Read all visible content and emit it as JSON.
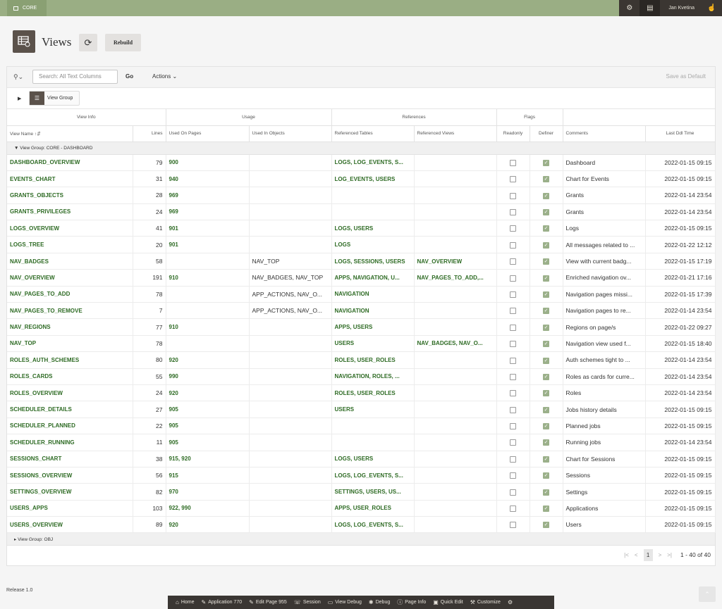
{
  "topbar": {
    "app_label": "CORE",
    "user_name": "Jan Kvetina"
  },
  "page": {
    "title": "Views",
    "rebuild_label": "Rebuild"
  },
  "toolbar": {
    "search_placeholder": "Search: All Text Columns",
    "go_label": "Go",
    "actions_label": "Actions",
    "save_default_label": "Save as Default"
  },
  "view_group_button": "View Group",
  "column_groups": {
    "view_info": "View Info",
    "usage": "Usage",
    "references": "References",
    "flags": "Flags"
  },
  "columns": {
    "view_name": "View Name",
    "lines": "Lines",
    "used_on_pages": "Used On Pages",
    "used_in_objects": "Used In Objects",
    "referenced_tables": "Referenced Tables",
    "referenced_views": "Referenced Views",
    "readonly": "Readonly",
    "definer": "Definer",
    "comments": "Comments",
    "last_ddl_time": "Last Ddl Time"
  },
  "break_groups": [
    "View Group: CORE - DASHBOARD",
    "View Group: OBJ"
  ],
  "rows": [
    {
      "name": "DASHBOARD_OVERVIEW",
      "lines": "79",
      "pages": "900",
      "objects": "",
      "tables": "LOGS, LOG_EVENTS, S...",
      "views": "",
      "readonly": false,
      "definer": true,
      "comment": "Dashboard",
      "ddl": "2022-01-15 09:15"
    },
    {
      "name": "EVENTS_CHART",
      "lines": "31",
      "pages": "940",
      "objects": "",
      "tables": "LOG_EVENTS, USERS",
      "views": "",
      "readonly": false,
      "definer": true,
      "comment": "Chart for Events",
      "ddl": "2022-01-15 09:15"
    },
    {
      "name": "GRANTS_OBJECTS",
      "lines": "28",
      "pages": "969",
      "objects": "",
      "tables": "",
      "views": "",
      "readonly": false,
      "definer": true,
      "comment": "Grants",
      "ddl": "2022-01-14 23:54"
    },
    {
      "name": "GRANTS_PRIVILEGES",
      "lines": "24",
      "pages": "969",
      "objects": "",
      "tables": "",
      "views": "",
      "readonly": false,
      "definer": true,
      "comment": "Grants",
      "ddl": "2022-01-14 23:54"
    },
    {
      "name": "LOGS_OVERVIEW",
      "lines": "41",
      "pages": "901",
      "objects": "",
      "tables": "LOGS, USERS",
      "views": "",
      "readonly": false,
      "definer": true,
      "comment": "Logs",
      "ddl": "2022-01-15 09:15"
    },
    {
      "name": "LOGS_TREE",
      "lines": "20",
      "pages": "901",
      "objects": "",
      "tables": "LOGS",
      "views": "",
      "readonly": false,
      "definer": true,
      "comment": "All messages related to ...",
      "ddl": "2022-01-22 12:12"
    },
    {
      "name": "NAV_BADGES",
      "lines": "58",
      "pages": "",
      "objects": "NAV_TOP",
      "tables": "LOGS, SESSIONS, USERS",
      "views": "NAV_OVERVIEW",
      "readonly": false,
      "definer": true,
      "comment": "View with current badg...",
      "ddl": "2022-01-15 17:19"
    },
    {
      "name": "NAV_OVERVIEW",
      "lines": "191",
      "pages": "910",
      "objects": "NAV_BADGES, NAV_TOP",
      "tables": "APPS, NAVIGATION, U...",
      "views": "NAV_PAGES_TO_ADD,...",
      "readonly": false,
      "definer": true,
      "comment": "Enriched navigation ov...",
      "ddl": "2022-01-21 17:16"
    },
    {
      "name": "NAV_PAGES_TO_ADD",
      "lines": "78",
      "pages": "",
      "objects": "APP_ACTIONS, NAV_O...",
      "tables": "NAVIGATION",
      "views": "",
      "readonly": false,
      "definer": true,
      "comment": "Navigation pages missi...",
      "ddl": "2022-01-15 17:39"
    },
    {
      "name": "NAV_PAGES_TO_REMOVE",
      "lines": "7",
      "pages": "",
      "objects": "APP_ACTIONS, NAV_O...",
      "tables": "NAVIGATION",
      "views": "",
      "readonly": false,
      "definer": true,
      "comment": "Navigation pages to re...",
      "ddl": "2022-01-14 23:54"
    },
    {
      "name": "NAV_REGIONS",
      "lines": "77",
      "pages": "910",
      "objects": "",
      "tables": "APPS, USERS",
      "views": "",
      "readonly": false,
      "definer": true,
      "comment": "Regions on page/s",
      "ddl": "2022-01-22 09:27"
    },
    {
      "name": "NAV_TOP",
      "lines": "78",
      "pages": "",
      "objects": "",
      "tables": "USERS",
      "views": "NAV_BADGES, NAV_O...",
      "readonly": false,
      "definer": true,
      "comment": "Navigation view used f...",
      "ddl": "2022-01-15 18:40"
    },
    {
      "name": "ROLES_AUTH_SCHEMES",
      "lines": "80",
      "pages": "920",
      "objects": "",
      "tables": "ROLES, USER_ROLES",
      "views": "",
      "readonly": false,
      "definer": true,
      "comment": "Auth schemes tight to ...",
      "ddl": "2022-01-14 23:54"
    },
    {
      "name": "ROLES_CARDS",
      "lines": "55",
      "pages": "990",
      "objects": "",
      "tables": "NAVIGATION, ROLES, ...",
      "views": "",
      "readonly": false,
      "definer": true,
      "comment": "Roles as cards for curre...",
      "ddl": "2022-01-14 23:54"
    },
    {
      "name": "ROLES_OVERVIEW",
      "lines": "24",
      "pages": "920",
      "objects": "",
      "tables": "ROLES, USER_ROLES",
      "views": "",
      "readonly": false,
      "definer": true,
      "comment": "Roles",
      "ddl": "2022-01-14 23:54"
    },
    {
      "name": "SCHEDULER_DETAILS",
      "lines": "27",
      "pages": "905",
      "objects": "",
      "tables": "USERS",
      "views": "",
      "readonly": false,
      "definer": true,
      "comment": "Jobs history details",
      "ddl": "2022-01-15 09:15"
    },
    {
      "name": "SCHEDULER_PLANNED",
      "lines": "22",
      "pages": "905",
      "objects": "",
      "tables": "",
      "views": "",
      "readonly": false,
      "definer": true,
      "comment": "Planned jobs",
      "ddl": "2022-01-15 09:15"
    },
    {
      "name": "SCHEDULER_RUNNING",
      "lines": "11",
      "pages": "905",
      "objects": "",
      "tables": "",
      "views": "",
      "readonly": false,
      "definer": true,
      "comment": "Running jobs",
      "ddl": "2022-01-14 23:54"
    },
    {
      "name": "SESSIONS_CHART",
      "lines": "38",
      "pages": "915, 920",
      "objects": "",
      "tables": "LOGS, USERS",
      "views": "",
      "readonly": false,
      "definer": true,
      "comment": "Chart for Sessions",
      "ddl": "2022-01-15 09:15"
    },
    {
      "name": "SESSIONS_OVERVIEW",
      "lines": "56",
      "pages": "915",
      "objects": "",
      "tables": "LOGS, LOG_EVENTS, S...",
      "views": "",
      "readonly": false,
      "definer": true,
      "comment": "Sessions",
      "ddl": "2022-01-15 09:15"
    },
    {
      "name": "SETTINGS_OVERVIEW",
      "lines": "82",
      "pages": "970",
      "objects": "",
      "tables": "SETTINGS, USERS, US...",
      "views": "",
      "readonly": false,
      "definer": true,
      "comment": "Settings",
      "ddl": "2022-01-15 09:15"
    },
    {
      "name": "USERS_APPS",
      "lines": "103",
      "pages": "922, 990",
      "objects": "",
      "tables": "APPS, USER_ROLES",
      "views": "",
      "readonly": false,
      "definer": true,
      "comment": "Applications",
      "ddl": "2022-01-15 09:15"
    },
    {
      "name": "USERS_OVERVIEW",
      "lines": "89",
      "pages": "920",
      "objects": "",
      "tables": "LOGS, LOG_EVENTS, S...",
      "views": "",
      "readonly": false,
      "definer": true,
      "comment": "Users",
      "ddl": "2022-01-15 09:15"
    }
  ],
  "pagination": {
    "current_page": "1",
    "range": "1 - 40 of 40"
  },
  "footer": {
    "release": "Release 1.0"
  },
  "devbar": [
    {
      "icon": "home-icon",
      "glyph": "⌂",
      "label": "Home"
    },
    {
      "icon": "pencil-icon",
      "glyph": "✎",
      "label": "Application 770"
    },
    {
      "icon": "edit-page-icon",
      "glyph": "✎",
      "label": "Edit Page 955"
    },
    {
      "icon": "session-icon",
      "glyph": "☏",
      "label": "Session"
    },
    {
      "icon": "view-debug-icon",
      "glyph": "▭",
      "label": "View Debug"
    },
    {
      "icon": "bug-icon",
      "glyph": "✱",
      "label": "Debug"
    },
    {
      "icon": "info-icon",
      "glyph": "ⓘ",
      "label": "Page Info"
    },
    {
      "icon": "quick-edit-icon",
      "glyph": "▣",
      "label": "Quick Edit"
    },
    {
      "icon": "customize-icon",
      "glyph": "⚒",
      "label": "Customize"
    },
    {
      "icon": "gear-icon",
      "glyph": "⚙",
      "label": ""
    }
  ]
}
